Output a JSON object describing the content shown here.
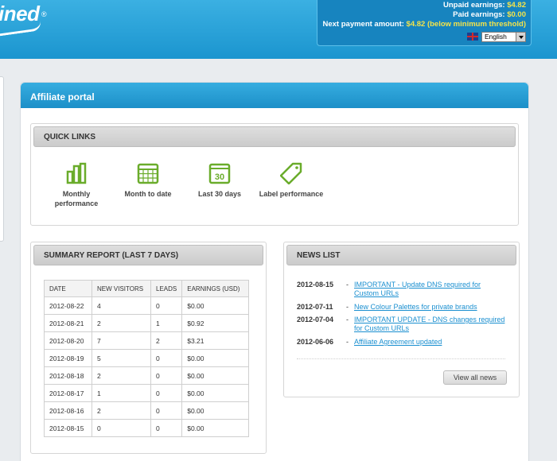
{
  "brand": {
    "logo_text": "ined",
    "registered": "®"
  },
  "earnings": {
    "unpaid_label": "Unpaid earnings:",
    "unpaid_value": "$4.82",
    "paid_label": "Paid earnings:",
    "paid_value": "$0.00",
    "next_label": "Next payment amount:",
    "next_value": "$4.82 (below minimum threshold)"
  },
  "language": {
    "selected": "English"
  },
  "portal": {
    "title": "Affiliate portal"
  },
  "quick_links": {
    "title": "QUICK LINKS",
    "items": [
      {
        "label": "Monthly performance",
        "icon": "bar-chart-icon"
      },
      {
        "label": "Month to date",
        "icon": "calendar-icon"
      },
      {
        "label": "Last 30 days",
        "icon": "calendar-30-icon",
        "badge": "30"
      },
      {
        "label": "Label performance",
        "icon": "tag-icon"
      }
    ]
  },
  "summary": {
    "title": "SUMMARY REPORT (LAST 7 DAYS)",
    "columns": [
      "DATE",
      "NEW VISITORS",
      "LEADS",
      "EARNINGS (USD)"
    ],
    "rows": [
      [
        "2012-08-22",
        "4",
        "0",
        "$0.00"
      ],
      [
        "2012-08-21",
        "2",
        "1",
        "$0.92"
      ],
      [
        "2012-08-20",
        "7",
        "2",
        "$3.21"
      ],
      [
        "2012-08-19",
        "5",
        "0",
        "$0.00"
      ],
      [
        "2012-08-18",
        "2",
        "0",
        "$0.00"
      ],
      [
        "2012-08-17",
        "1",
        "0",
        "$0.00"
      ],
      [
        "2012-08-16",
        "2",
        "0",
        "$0.00"
      ],
      [
        "2012-08-15",
        "0",
        "0",
        "$0.00"
      ]
    ]
  },
  "news": {
    "title": "NEWS LIST",
    "items": [
      {
        "date": "2012-08-15",
        "text": "IMPORTANT - Update DNS required for Custom URLs"
      },
      {
        "date": "2012-07-11",
        "text": "New Colour Palettes for private brands"
      },
      {
        "date": "2012-07-04",
        "text": "IMPORTANT UPDATE - DNS changes required for Custom URLs"
      },
      {
        "date": "2012-06-06",
        "text": "Affiliate Agreement updated"
      }
    ],
    "view_all": "View all news"
  },
  "colors": {
    "accent_green": "#6aac2b",
    "link_blue": "#1a8fd0",
    "header_blue": "#1b95cf",
    "highlight_yellow": "#f4e34a"
  }
}
